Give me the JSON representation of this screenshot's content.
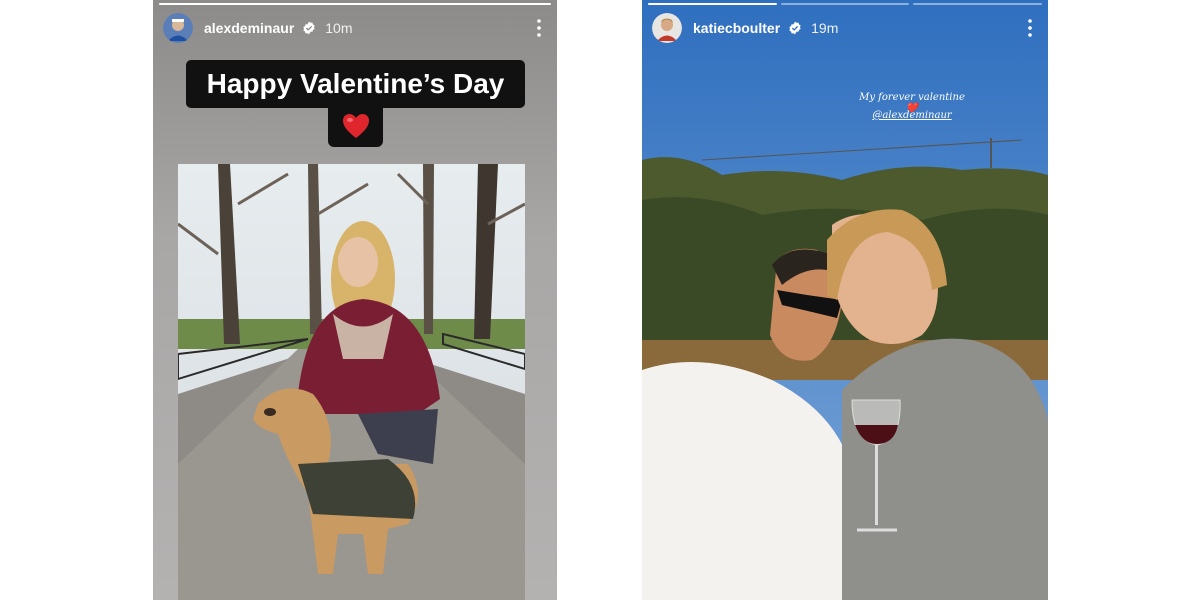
{
  "left_story": {
    "username": "alexdeminaur",
    "time": "10m",
    "sticker_text": "Happy Valentine’s Day",
    "heart_emoji": "❤️",
    "progress": {
      "segments": 1,
      "active": 1
    }
  },
  "right_story": {
    "username": "katiecboulter",
    "time": "19m",
    "caption": "My forever valentine ❤️",
    "mention": "@alexdeminaur",
    "progress": {
      "segments": 3,
      "active": 1
    }
  },
  "colors": {
    "verified_badge": "#ffffff",
    "heart": "#e0262d",
    "sticker_bg": "#111111"
  }
}
